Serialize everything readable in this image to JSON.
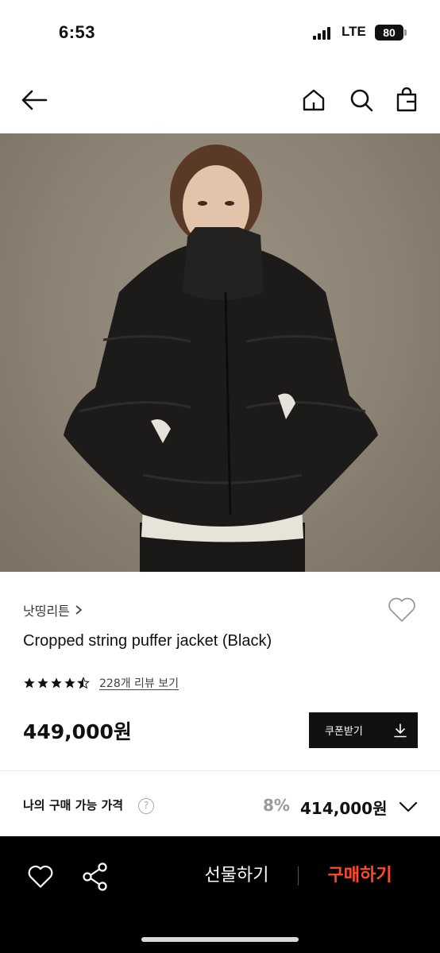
{
  "status_bar": {
    "time": "6:53",
    "network": "LTE",
    "battery": "80"
  },
  "nav": {
    "back_icon": "arrow-left-icon",
    "home_icon": "home-icon",
    "search_icon": "search-icon",
    "bag_icon": "shopping-bag-icon"
  },
  "product": {
    "brand": "낫띵리튼",
    "title": "Cropped string puffer jacket (Black)",
    "rating": 4.5,
    "reviews_link": "228개 리뷰 보기",
    "price": "449,000원"
  },
  "coupon": {
    "label": "쿠폰받기",
    "icon": "download-icon"
  },
  "my_price": {
    "label": "나의 구매 가능 가격",
    "help": "?",
    "discount_rate": "8%",
    "discounted_price": "414,000원"
  },
  "bottom_bar": {
    "gift_label": "선물하기",
    "buy_label": "구매하기",
    "heart_icon": "heart-outline-icon",
    "share_icon": "share-icon"
  },
  "colors": {
    "accent": "#ff4a24",
    "primary": "#111111",
    "muted": "#9a9a9a"
  }
}
